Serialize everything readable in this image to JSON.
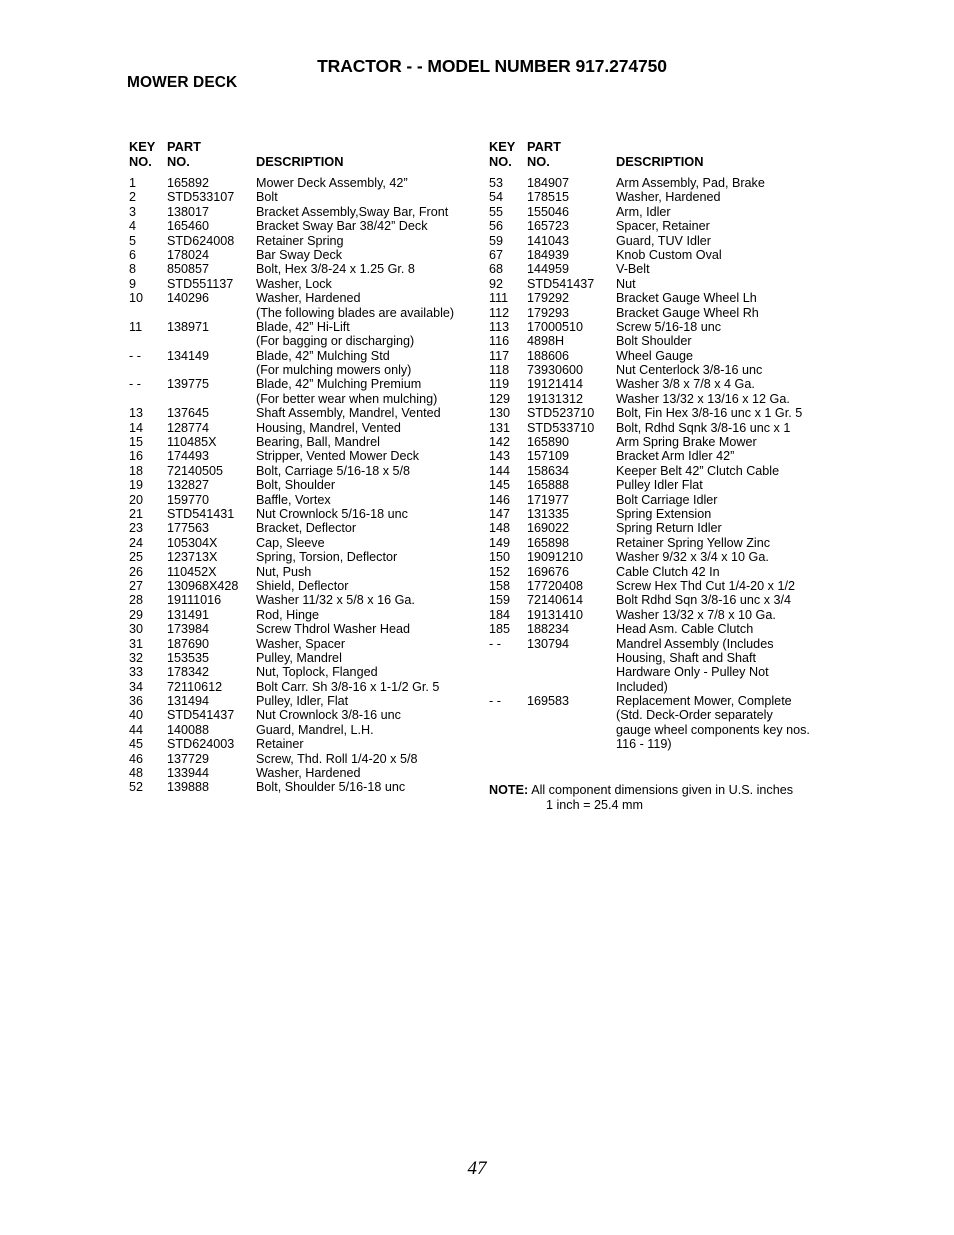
{
  "header": {
    "title": "TRACTOR - - MODEL NUMBER 917.274750",
    "section": "MOWER DECK"
  },
  "columns": {
    "headers": {
      "key_line1": "KEY",
      "key_line2": "NO.",
      "part_line1": "PART",
      "part_line2": "NO.",
      "description": "DESCRIPTION"
    },
    "left": [
      {
        "key": "1",
        "part": "165892",
        "desc": "Mower Deck Assembly, 42”"
      },
      {
        "key": "2",
        "part": "STD533107",
        "desc": "Bolt"
      },
      {
        "key": "3",
        "part": "138017",
        "desc": "Bracket Assembly,Sway Bar, Front"
      },
      {
        "key": "4",
        "part": "165460",
        "desc": "Bracket Sway Bar 38/42” Deck"
      },
      {
        "key": "5",
        "part": "STD624008",
        "desc": "Retainer Spring"
      },
      {
        "key": "6",
        "part": "178024",
        "desc": "Bar Sway Deck"
      },
      {
        "key": "8",
        "part": "850857",
        "desc": "Bolt, Hex  3/8-24 x 1.25 Gr. 8"
      },
      {
        "key": "9",
        "part": "STD551137",
        "desc": "Washer, Lock"
      },
      {
        "key": "10",
        "part": "140296",
        "desc": "Washer, Hardened"
      },
      {
        "key": "",
        "part": "",
        "desc": "(The following blades are available)"
      },
      {
        "key": "11",
        "part": "138971",
        "desc": "Blade, 42” Hi-Lift"
      },
      {
        "key": "",
        "part": "",
        "desc": "(For bagging or discharging)"
      },
      {
        "key": "- -",
        "part": "134149",
        "desc": "Blade, 42” Mulching Std"
      },
      {
        "key": "",
        "part": "",
        "desc": "(For mulching mowers only)"
      },
      {
        "key": "- -",
        "part": "139775",
        "desc": "Blade, 42” Mulching Premium"
      },
      {
        "key": "",
        "part": "",
        "desc": "(For better wear when mulching)"
      },
      {
        "key": "13",
        "part": "137645",
        "desc": "Shaft Assembly, Mandrel, Vented"
      },
      {
        "key": "14",
        "part": "128774",
        "desc": "Housing, Mandrel, Vented"
      },
      {
        "key": "15",
        "part": "110485X",
        "desc": "Bearing, Ball, Mandrel"
      },
      {
        "key": "16",
        "part": "174493",
        "desc": "Stripper, Vented Mower Deck"
      },
      {
        "key": "18",
        "part": "72140505",
        "desc": "Bolt, Carriage  5/16-18 x 5/8"
      },
      {
        "key": "19",
        "part": "132827",
        "desc": "Bolt, Shoulder"
      },
      {
        "key": "20",
        "part": "159770",
        "desc": "Baffle, Vortex"
      },
      {
        "key": "21",
        "part": "STD541431",
        "desc": "Nut Crownlock 5/16-18 unc"
      },
      {
        "key": "23",
        "part": "177563",
        "desc": "Bracket, Deflector"
      },
      {
        "key": "24",
        "part": "105304X",
        "desc": "Cap, Sleeve"
      },
      {
        "key": "25",
        "part": "123713X",
        "desc": "Spring, Torsion, Deflector"
      },
      {
        "key": "26",
        "part": "110452X",
        "desc": "Nut, Push"
      },
      {
        "key": "27",
        "part": "130968X428",
        "desc": "Shield, Deflector"
      },
      {
        "key": "28",
        "part": "19111016",
        "desc": "Washer  11/32 x 5/8 x 16 Ga."
      },
      {
        "key": "29",
        "part": "131491",
        "desc": "Rod, Hinge"
      },
      {
        "key": "30",
        "part": "173984",
        "desc": "Screw Thdrol Washer Head"
      },
      {
        "key": "31",
        "part": "187690",
        "desc": "Washer, Spacer"
      },
      {
        "key": "32",
        "part": "153535",
        "desc": "Pulley, Mandrel"
      },
      {
        "key": "33",
        "part": "178342",
        "desc": "Nut, Toplock, Flanged"
      },
      {
        "key": "34",
        "part": "72110612",
        "desc": "Bolt Carr. Sh 3/8-16 x 1-1/2 Gr. 5"
      },
      {
        "key": "36",
        "part": "131494",
        "desc": "Pulley, Idler, Flat"
      },
      {
        "key": "40",
        "part": "STD541437",
        "desc": "Nut Crownlock 3/8-16 unc"
      },
      {
        "key": "44",
        "part": "140088",
        "desc": "Guard, Mandrel, L.H."
      },
      {
        "key": "45",
        "part": "STD624003",
        "desc": "Retainer"
      },
      {
        "key": "46",
        "part": "137729",
        "desc": "Screw, Thd. Roll  1/4-20 x 5/8"
      },
      {
        "key": "48",
        "part": "133944",
        "desc": "Washer, Hardened"
      },
      {
        "key": "52",
        "part": "139888",
        "desc": "Bolt, Shoulder  5/16-18 unc"
      }
    ],
    "right": [
      {
        "key": "53",
        "part": "184907",
        "desc": "Arm Assembly, Pad, Brake"
      },
      {
        "key": "54",
        "part": "178515",
        "desc": "Washer, Hardened"
      },
      {
        "key": "55",
        "part": "155046",
        "desc": "Arm, Idler"
      },
      {
        "key": "56",
        "part": "165723",
        "desc": "Spacer, Retainer"
      },
      {
        "key": "59",
        "part": "141043",
        "desc": "Guard, TUV Idler"
      },
      {
        "key": "67",
        "part": "184939",
        "desc": "Knob Custom Oval"
      },
      {
        "key": "68",
        "part": "144959",
        "desc": "V-Belt"
      },
      {
        "key": "92",
        "part": "STD541437",
        "desc": "Nut"
      },
      {
        "key": "111",
        "part": "179292",
        "desc": "Bracket Gauge Wheel Lh"
      },
      {
        "key": "112",
        "part": "179293",
        "desc": "Bracket Gauge Wheel Rh"
      },
      {
        "key": "113",
        "part": "17000510",
        "desc": "Screw 5/16-18 unc"
      },
      {
        "key": "116",
        "part": "4898H",
        "desc": "Bolt Shoulder"
      },
      {
        "key": "117",
        "part": "188606",
        "desc": "Wheel Gauge"
      },
      {
        "key": "118",
        "part": "73930600",
        "desc": "Nut Centerlock 3/8-16 unc"
      },
      {
        "key": "119",
        "part": "19121414",
        "desc": "Washer 3/8 x 7/8 x 4 Ga."
      },
      {
        "key": "129",
        "part": "19131312",
        "desc": "Washer 13/32 x 13/16 x 12 Ga."
      },
      {
        "key": "130",
        "part": "STD523710",
        "desc": "Bolt, Fin Hex 3/8-16 unc x 1 Gr. 5"
      },
      {
        "key": "131",
        "part": "STD533710",
        "desc": "Bolt, Rdhd Sqnk 3/8-16 unc x 1"
      },
      {
        "key": "142",
        "part": "165890",
        "desc": "Arm Spring Brake Mower"
      },
      {
        "key": "143",
        "part": "157109",
        "desc": "Bracket Arm Idler 42”"
      },
      {
        "key": "144",
        "part": "158634",
        "desc": "Keeper Belt 42” Clutch Cable"
      },
      {
        "key": "145",
        "part": "165888",
        "desc": "Pulley Idler Flat"
      },
      {
        "key": "146",
        "part": "171977",
        "desc": "Bolt Carriage Idler"
      },
      {
        "key": "147",
        "part": "131335",
        "desc": "Spring Extension"
      },
      {
        "key": "148",
        "part": "169022",
        "desc": "Spring Return Idler"
      },
      {
        "key": "149",
        "part": "165898",
        "desc": "Retainer Spring Yellow Zinc"
      },
      {
        "key": "150",
        "part": "19091210",
        "desc": "Washer  9/32 x 3/4 x 10 Ga."
      },
      {
        "key": "152",
        "part": "169676",
        "desc": "Cable Clutch 42 In"
      },
      {
        "key": "158",
        "part": "17720408",
        "desc": "Screw Hex Thd Cut 1/4-20 x 1/2"
      },
      {
        "key": "159",
        "part": "72140614",
        "desc": "Bolt Rdhd Sqn 3/8-16 unc x 3/4"
      },
      {
        "key": "184",
        "part": "19131410",
        "desc": "Washer 13/32 x 7/8 x 10 Ga."
      },
      {
        "key": "185",
        "part": "188234",
        "desc": "Head Asm. Cable Clutch"
      },
      {
        "key": "- -",
        "part": "130794",
        "desc": "Mandrel Assembly (Includes"
      },
      {
        "key": "",
        "part": "",
        "desc": "Housing, Shaft and Shaft"
      },
      {
        "key": "",
        "part": "",
        "desc": "Hardware Only - Pulley Not"
      },
      {
        "key": "",
        "part": "",
        "desc": "Included)"
      },
      {
        "key": "- -",
        "part": "169583",
        "desc": "Replacement Mower, Complete"
      },
      {
        "key": "",
        "part": "",
        "desc": "(Std. Deck-Order separately"
      },
      {
        "key": "",
        "part": "",
        "desc": "gauge wheel components key nos."
      },
      {
        "key": "",
        "part": "",
        "desc": "116 - 119)"
      }
    ]
  },
  "note": {
    "label": "NOTE:",
    "line1": "All component dimensions given in U.S. inches",
    "line2": "1 inch = 25.4 mm"
  },
  "footer": {
    "page_number": "47"
  }
}
